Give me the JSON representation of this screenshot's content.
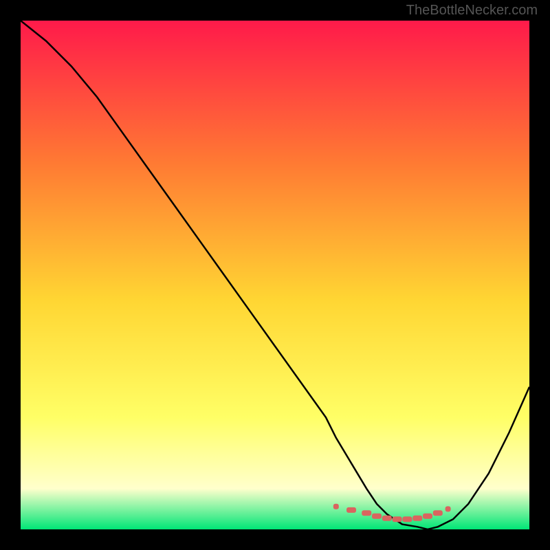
{
  "watermark": "TheBottleNecker.com",
  "colors": {
    "gradient_top": "#ff1a4a",
    "gradient_mid1": "#ff7a33",
    "gradient_mid2": "#ffd633",
    "gradient_mid3": "#ffff66",
    "gradient_mid4": "#ffffcc",
    "gradient_bottom": "#00e676",
    "curve": "#000000",
    "marker": "#d9645f",
    "background": "#000000"
  },
  "chart_data": {
    "type": "line",
    "title": "",
    "xlabel": "",
    "ylabel": "",
    "xlim": [
      0,
      100
    ],
    "ylim": [
      0,
      100
    ],
    "series": [
      {
        "name": "bottleneck-curve",
        "x": [
          0,
          5,
          10,
          15,
          20,
          25,
          30,
          35,
          40,
          45,
          50,
          55,
          60,
          62,
          65,
          68,
          70,
          72,
          75,
          78,
          80,
          82,
          85,
          88,
          92,
          96,
          100
        ],
        "values": [
          100,
          96,
          91,
          85,
          78,
          71,
          64,
          57,
          50,
          43,
          36,
          29,
          22,
          18,
          13,
          8,
          5,
          3,
          1,
          0.5,
          0,
          0.5,
          2,
          5,
          11,
          19,
          28
        ]
      }
    ],
    "markers": {
      "name": "optimal-range",
      "x": [
        62,
        65,
        68,
        70,
        72,
        74,
        76,
        78,
        80,
        82,
        84
      ],
      "values": [
        4.5,
        3.8,
        3.2,
        2.6,
        2.2,
        2.0,
        2.0,
        2.2,
        2.6,
        3.2,
        4.0
      ]
    }
  }
}
